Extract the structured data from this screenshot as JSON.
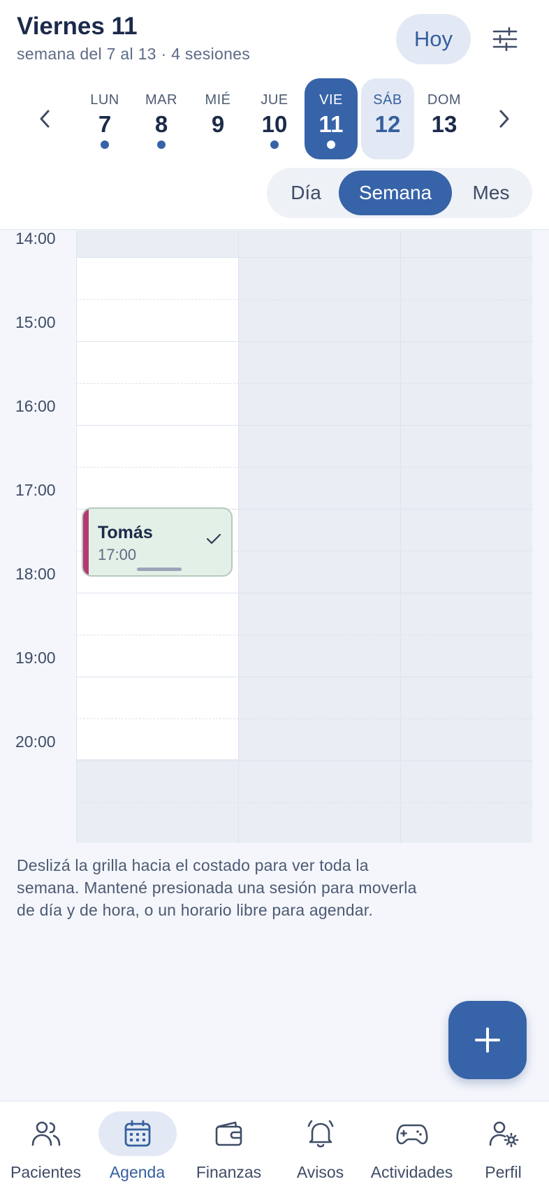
{
  "header": {
    "title": "Viernes 11",
    "subtitle": "semana del 7 al 13 · 4 sesiones",
    "today_label": "Hoy"
  },
  "week": [
    {
      "name": "LUN",
      "num": "7",
      "has_sessions": true,
      "state": "normal"
    },
    {
      "name": "MAR",
      "num": "8",
      "has_sessions": true,
      "state": "normal"
    },
    {
      "name": "MIÉ",
      "num": "9",
      "has_sessions": false,
      "state": "normal"
    },
    {
      "name": "JUE",
      "num": "10",
      "has_sessions": true,
      "state": "normal"
    },
    {
      "name": "VIE",
      "num": "11",
      "has_sessions": true,
      "state": "selected"
    },
    {
      "name": "SÁB",
      "num": "12",
      "has_sessions": false,
      "state": "weekend"
    },
    {
      "name": "DOM",
      "num": "13",
      "has_sessions": false,
      "state": "normal"
    }
  ],
  "view_switch": {
    "options": [
      "Día",
      "Semana",
      "Mes"
    ],
    "selected": "Semana"
  },
  "grid": {
    "hours": [
      "14:00",
      "15:00",
      "16:00",
      "17:00",
      "18:00",
      "19:00",
      "20:00"
    ]
  },
  "event": {
    "name": "Tomás",
    "time": "17:00"
  },
  "hint": "Deslizá la grilla hacia el costado para ver toda la semana. Mantené presionada una sesión para moverla de día y de hora, o un horario libre para agendar.",
  "tabs": [
    {
      "label": "Pacientes",
      "icon": "patients-icon",
      "active": false
    },
    {
      "label": "Agenda",
      "icon": "calendar-icon",
      "active": true
    },
    {
      "label": "Finanzas",
      "icon": "wallet-icon",
      "active": false
    },
    {
      "label": "Avisos",
      "icon": "bell-icon",
      "active": false
    },
    {
      "label": "Actividades",
      "icon": "gamepad-icon",
      "active": false
    },
    {
      "label": "Perfil",
      "icon": "profile-settings-icon",
      "active": false
    }
  ],
  "colors": {
    "accent": "#3763a8",
    "accent_soft": "#e3e9f4",
    "event_bg": "#e3f0e7",
    "event_bar": "#b33b72"
  }
}
